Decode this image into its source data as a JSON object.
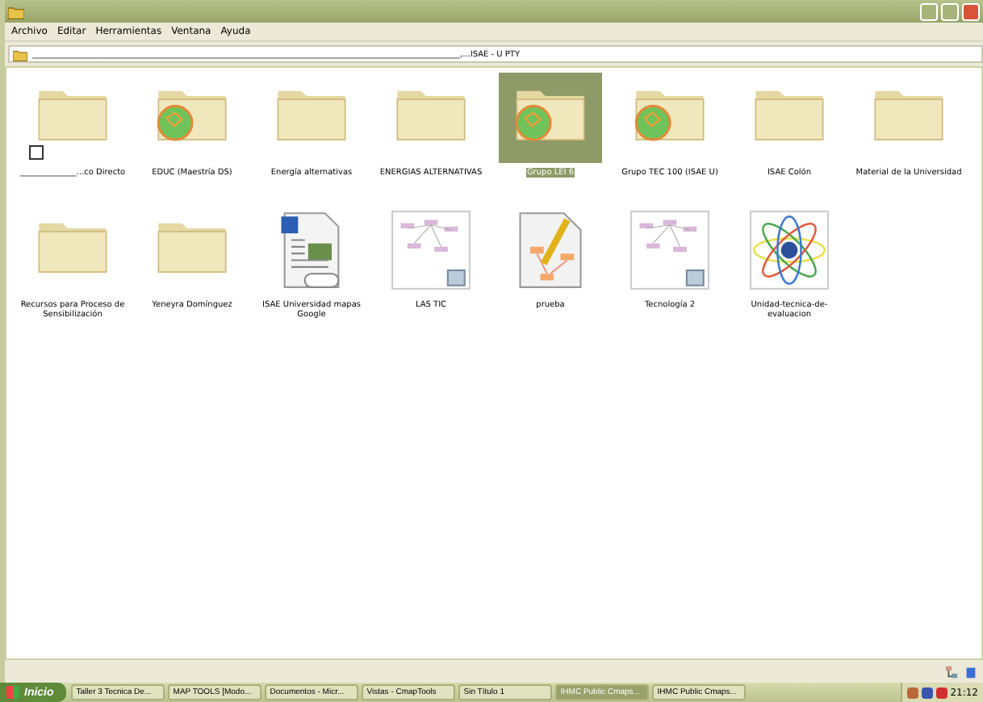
{
  "menu": [
    "Archivo",
    "Editar",
    "Herramientas",
    "Ventana",
    "Ayuda"
  ],
  "address": {
    "value": "__________________________________________________________________________________________________________,...ISAE - U PTY"
  },
  "items": [
    {
      "kind": "folder",
      "label": "______________...co Directo",
      "shortcut": true,
      "selected": false
    },
    {
      "kind": "cmap-folder",
      "label": "EDUC (Maestría DS)",
      "shortcut": false,
      "selected": false
    },
    {
      "kind": "folder",
      "label": "Energía alternativas",
      "shortcut": false,
      "selected": false
    },
    {
      "kind": "folder",
      "label": "ENERGIAS ALTERNATIVAS",
      "shortcut": false,
      "selected": false
    },
    {
      "kind": "cmap-folder",
      "label": "Grupo LEI 6",
      "shortcut": false,
      "selected": true
    },
    {
      "kind": "cmap-folder",
      "label": "Grupo TEC 100 (ISAE U)",
      "shortcut": false,
      "selected": false
    },
    {
      "kind": "folder",
      "label": "ISAE Colón",
      "shortcut": false,
      "selected": false
    },
    {
      "kind": "folder",
      "label": "Material de la Universidad",
      "shortcut": false,
      "selected": false
    },
    {
      "kind": "folder",
      "label": "Recursos para Proceso de Sensibilización",
      "shortcut": false,
      "selected": false
    },
    {
      "kind": "folder",
      "label": "Yeneyra Domínguez",
      "shortcut": false,
      "selected": false
    },
    {
      "kind": "doc",
      "label": "ISAE Universidad mapas Google",
      "shortcut": false,
      "selected": false
    },
    {
      "kind": "map",
      "label": "LAS TIC",
      "shortcut": false,
      "selected": false
    },
    {
      "kind": "cmap",
      "label": "prueba",
      "shortcut": false,
      "selected": false
    },
    {
      "kind": "map",
      "label": "Tecnología 2",
      "shortcut": false,
      "selected": false
    },
    {
      "kind": "atom",
      "label": "Unidad-tecnica-de-evaluacion",
      "shortcut": false,
      "selected": false
    }
  ],
  "taskbar": {
    "start": "Inicio",
    "tasks": [
      {
        "label": "Taller 3 Tecnica De...",
        "selected": false
      },
      {
        "label": "MAP TOOLS [Modo...",
        "selected": false
      },
      {
        "label": "Documentos - Micr...",
        "selected": false
      },
      {
        "label": "Vistas - CmapTools",
        "selected": false
      },
      {
        "label": "Sin Título 1",
        "selected": false
      },
      {
        "label": "IHMC Public Cmaps...",
        "selected": true
      },
      {
        "label": "IHMC Public Cmaps...",
        "selected": false
      }
    ],
    "clock": "21:12"
  }
}
